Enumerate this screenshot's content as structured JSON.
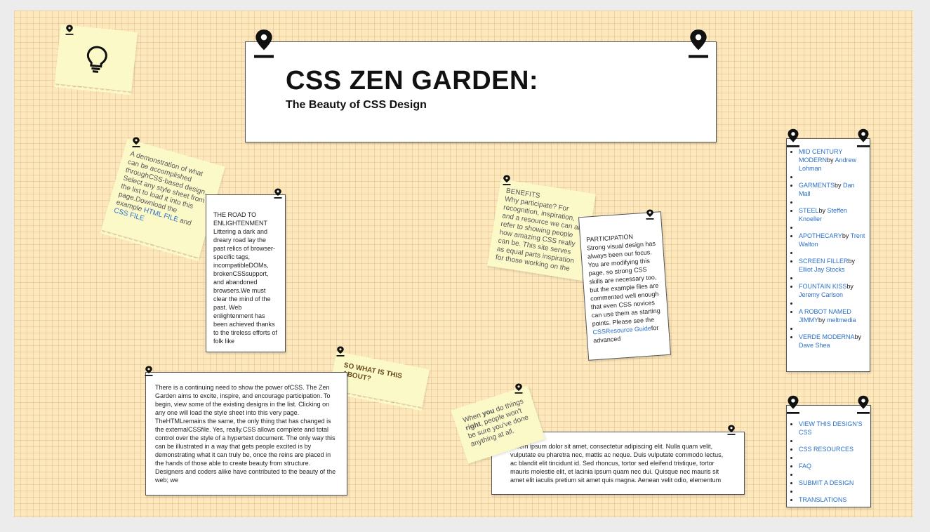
{
  "header": {
    "title": "CSS ZEN GARDEN:",
    "subtitle": "The Beauty of CSS Design"
  },
  "intro": {
    "text": "A demonstration of what can be accomplished throughCSS-based design. Select any style sheet from the list to load it into this page.Download the example ",
    "html_link": "HTML FILE",
    "and": " and ",
    "css_link": "CSS FILE"
  },
  "road": {
    "heading": "THE ROAD TO ENLIGHTENMENT",
    "text": "Littering a dark and dreary road lay the past relics of browser-specific tags, incompatibleDOMs, brokenCSSsupport, and abandoned browsers.We must clear the mind of the past. Web enlightenment has been achieved thanks to the tireless efforts of folk like"
  },
  "benefits": {
    "heading": "BENEFITS",
    "text": "Why participate? For recognition, inspiration, and a resource we can all refer to showing people how amazing CSS really can be. This site serves as equal parts inspiration for those working on the"
  },
  "participation": {
    "heading": "PARTICIPATION",
    "text": "Strong visual design has always been our focus. You are modifying this page, so strong CSS skills are necessary too, but the example files are commented well enough that even CSS novices can use them as starting points. Please see the ",
    "link": "CSSResource Guide",
    "tail": "for advanced"
  },
  "what": {
    "heading": "SO WHAT IS THIS ABOUT?"
  },
  "about": {
    "text": "There is a continuing need to show the power ofCSS. The Zen Garden aims to excite, inspire, and encourage participation. To begin, view some of the existing designs in the list. Clicking on any one will load the style sheet into this very page. TheHTMLremains the same, the only thing that has changed is the externalCSSfile. Yes, really.CSS allows complete and total control over the style of a hypertext document. The only way this can be illustrated in a way that gets people excited is by demonstrating what it can truly be, once the reins are placed in the hands of those able to create beauty from structure. Designers and coders alike have contributed to the beauty of the web; we"
  },
  "right_note": {
    "p1": "When ",
    "you": "you",
    "p2": " do things ",
    "right": "right",
    "p3": ", people won't be sure you've done anything at all."
  },
  "lorem": {
    "text": "Lorem ipsum dolor sit amet, consectetur adipiscing elit. Nulla quam velit, vulputate eu pharetra nec, mattis ac neque. Duis vulputate commodo lectus, ac blandit elit tincidunt id. Sed rhoncus, tortor sed eleifend tristique, tortor mauris molestie elit, et lacinia ipsum quam nec dui. Quisque nec mauris sit amet elit iaculis pretium sit amet quis magna. Aenean velit odio, elementum"
  },
  "designs": [
    {
      "name": "MID CENTURY MODERN",
      "by": "by ",
      "author": "Andrew Lohman"
    },
    {
      "name": "GARMENTS",
      "by": "by ",
      "author": "Dan Mall"
    },
    {
      "name": "STEEL",
      "by": "by ",
      "author": "Steffen Knoeller"
    },
    {
      "name": "APOTHECARY",
      "by": "by ",
      "author": "Trent Walton"
    },
    {
      "name": "SCREEN FILLER",
      "by": "by ",
      "author": "Elliot Jay Stocks"
    },
    {
      "name": "FOUNTAIN KISS",
      "by": "by ",
      "author": "Jeremy Carlson"
    },
    {
      "name": "A ROBOT NAMED JIMMY",
      "by": "by ",
      "author": "meltmedia"
    },
    {
      "name": "VERDE MODERNA",
      "by": "by ",
      "author": "Dave Shea"
    }
  ],
  "resources": [
    "VIEW THIS DESIGN'S CSS",
    "CSS RESOURCES",
    "FAQ",
    "SUBMIT A DESIGN",
    "TRANSLATIONS"
  ],
  "icons": {
    "pin": "map-pin-icon",
    "bulb": "lightbulb-icon"
  },
  "colors": {
    "board": "#fde8bd",
    "sticky": "#fcf9c9",
    "link": "#2a6fc9"
  }
}
